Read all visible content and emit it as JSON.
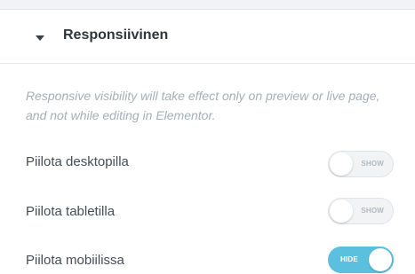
{
  "section": {
    "title": "Responsiivinen"
  },
  "note": "Responsive visibility will take effect only on preview or live page, and not while editing in Elementor.",
  "rows": [
    {
      "label": "Piilota desktopilla",
      "toggle_text": "SHOW",
      "state": "off"
    },
    {
      "label": "Piilota tabletilla",
      "toggle_text": "SHOW",
      "state": "off"
    },
    {
      "label": "Piilota mobiilissa",
      "toggle_text": "HIDE",
      "state": "on"
    }
  ],
  "colors": {
    "accent": "#5bc0de",
    "toggle_off_bg": "#f1f3f5",
    "note_text": "#a4afb7"
  }
}
